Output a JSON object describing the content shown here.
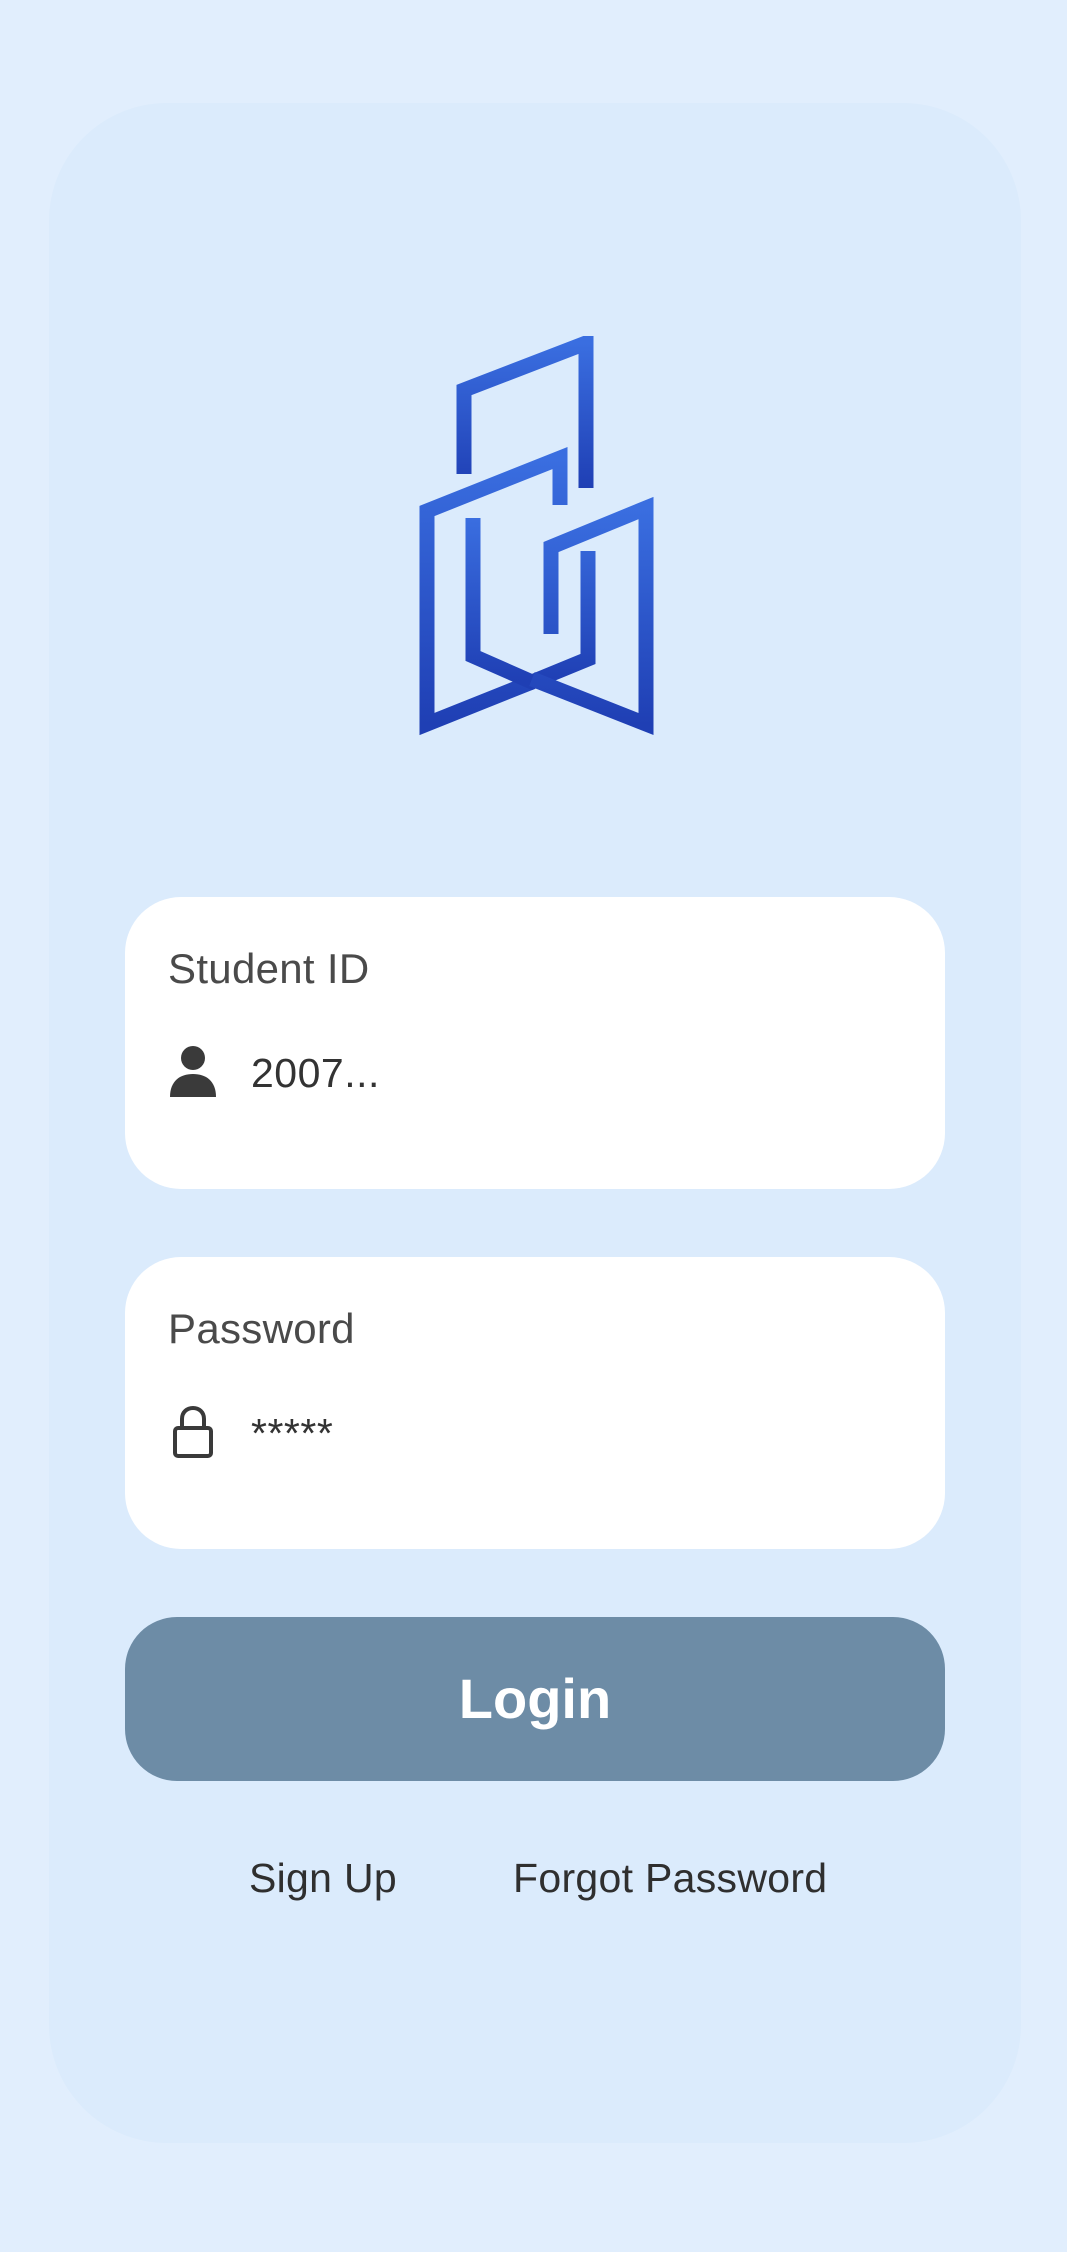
{
  "colors": {
    "page_background": "#e1eefd",
    "card_background": "#dbebfc",
    "logo_gradient_top": "#3a6ee0",
    "logo_gradient_bottom": "#1f3fb4",
    "login_button": "#6d8ca6",
    "field_background": "#ffffff"
  },
  "logo": {
    "icon": "building-logo-icon"
  },
  "student_id": {
    "label": "Student ID",
    "value": "2007...",
    "icon": "person-icon"
  },
  "password": {
    "label": "Password",
    "value": "*****",
    "icon": "lock-icon"
  },
  "login_button": {
    "label": "Login"
  },
  "links": {
    "sign_up": "Sign Up",
    "forgot_password": "Forgot Password"
  }
}
